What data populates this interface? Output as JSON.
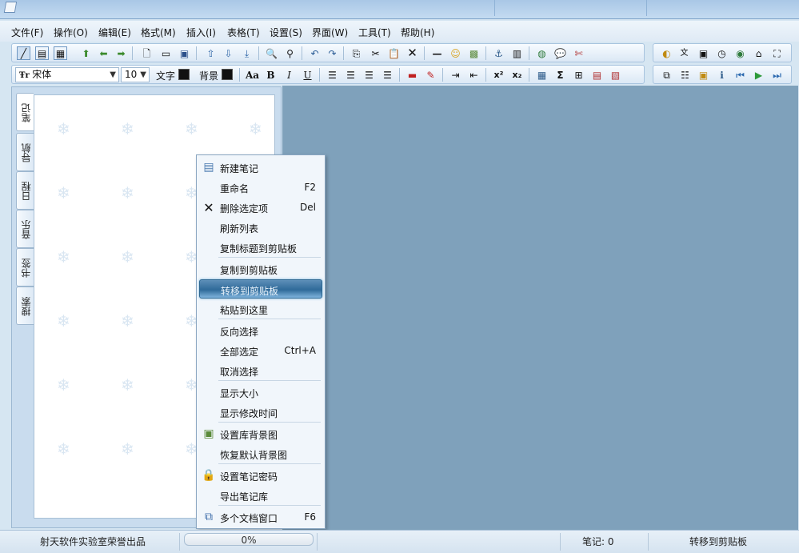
{
  "menubar": [
    {
      "label": "文件(F)",
      "name": "menu-file"
    },
    {
      "label": "操作(O)",
      "name": "menu-operation"
    },
    {
      "label": "编辑(E)",
      "name": "menu-edit"
    },
    {
      "label": "格式(M)",
      "name": "menu-format"
    },
    {
      "label": "插入(I)",
      "name": "menu-insert"
    },
    {
      "label": "表格(T)",
      "name": "menu-table"
    },
    {
      "label": "设置(S)",
      "name": "menu-settings"
    },
    {
      "label": "界面(W)",
      "name": "menu-interface"
    },
    {
      "label": "工具(T)",
      "name": "menu-tools"
    },
    {
      "label": "帮助(H)",
      "name": "menu-help"
    }
  ],
  "format_toolbar": {
    "font_name": "宋体",
    "font_size": "10",
    "text_color_label": "文字",
    "bg_color_label": "背景",
    "bold": "B",
    "italic": "I",
    "underline": "U",
    "sum_symbol": "Σ",
    "font_case": "Aa",
    "superscript": "x²",
    "subscript": "x₂",
    "text_color": "#111111",
    "bg_color": "#111111"
  },
  "side_tabs": [
    "笔记",
    "导航",
    "日程",
    "音乐",
    "书签",
    "搜索"
  ],
  "context_menu": [
    {
      "label": "新建笔记",
      "shortcut": "",
      "icon": "new-note-icon"
    },
    {
      "label": "重命名",
      "shortcut": "F2",
      "icon": ""
    },
    {
      "label": "删除选定项",
      "shortcut": "Del",
      "icon": "delete-icon"
    },
    {
      "label": "刷新列表",
      "shortcut": "",
      "icon": ""
    },
    {
      "label": "复制标题到剪贴板",
      "shortcut": "",
      "icon": ""
    },
    {
      "label": "复制到剪贴板",
      "shortcut": "",
      "icon": ""
    },
    {
      "label": "转移到剪贴板",
      "shortcut": "",
      "icon": "",
      "highlighted": true
    },
    {
      "label": "粘贴到这里",
      "shortcut": "",
      "icon": ""
    },
    {
      "label": "反向选择",
      "shortcut": "",
      "icon": ""
    },
    {
      "label": "全部选定",
      "shortcut": "Ctrl+A",
      "icon": ""
    },
    {
      "label": "取消选择",
      "shortcut": "",
      "icon": ""
    },
    {
      "label": "显示大小",
      "shortcut": "",
      "icon": ""
    },
    {
      "label": "显示修改时间",
      "shortcut": "",
      "icon": ""
    },
    {
      "label": "设置库背景图",
      "shortcut": "",
      "icon": "image-icon"
    },
    {
      "label": "恢复默认背景图",
      "shortcut": "",
      "icon": ""
    },
    {
      "label": "设置笔记密码",
      "shortcut": "",
      "icon": "lock-icon"
    },
    {
      "label": "导出笔记库",
      "shortcut": "",
      "icon": ""
    },
    {
      "label": "多个文档窗口",
      "shortcut": "F6",
      "icon": "multi-window-icon"
    }
  ],
  "statusbar": {
    "credit": "射天软件实验室荣誉出品",
    "progress_text": "0%",
    "progress_value": 0,
    "note_count": "笔记: 0",
    "status_message": "转移到剪贴板"
  },
  "colors": {
    "main_area": "#7fa1bb",
    "highlight": "#2f6a99"
  }
}
